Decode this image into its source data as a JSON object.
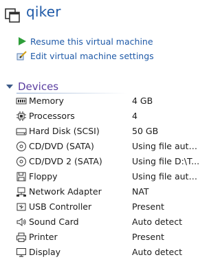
{
  "vm": {
    "name": "qiker",
    "icon": "vm-library-icon"
  },
  "actions": {
    "resume": {
      "label": "Resume this virtual machine",
      "icon": "play-icon",
      "color": "#2e9e3a"
    },
    "edit": {
      "label": "Edit virtual machine settings",
      "icon": "edit-settings-icon"
    }
  },
  "devices_section": {
    "title": "Devices",
    "expanded": true
  },
  "devices": [
    {
      "name": "Memory",
      "value": "4 GB",
      "icon": "memory-icon"
    },
    {
      "name": "Processors",
      "value": "4",
      "icon": "processor-icon"
    },
    {
      "name": "Hard Disk (SCSI)",
      "value": "50 GB",
      "icon": "hard-disk-icon"
    },
    {
      "name": "CD/DVD (SATA)",
      "value": "Using file autoi...",
      "icon": "cd-dvd-icon"
    },
    {
      "name": "CD/DVD 2 (SATA)",
      "value": "Using file D:\\T...",
      "icon": "cd-dvd-icon"
    },
    {
      "name": "Floppy",
      "value": "Using file autoi...",
      "icon": "floppy-icon"
    },
    {
      "name": "Network Adapter",
      "value": "NAT",
      "icon": "network-adapter-icon"
    },
    {
      "name": "USB Controller",
      "value": "Present",
      "icon": "usb-icon"
    },
    {
      "name": "Sound Card",
      "value": "Auto detect",
      "icon": "speaker-icon"
    },
    {
      "name": "Printer",
      "value": "Present",
      "icon": "printer-icon"
    },
    {
      "name": "Display",
      "value": "Auto detect",
      "icon": "display-icon"
    }
  ],
  "colors": {
    "title": "#1f5aa8",
    "section_title": "#5a3ea0",
    "link": "#1f5aa8"
  }
}
